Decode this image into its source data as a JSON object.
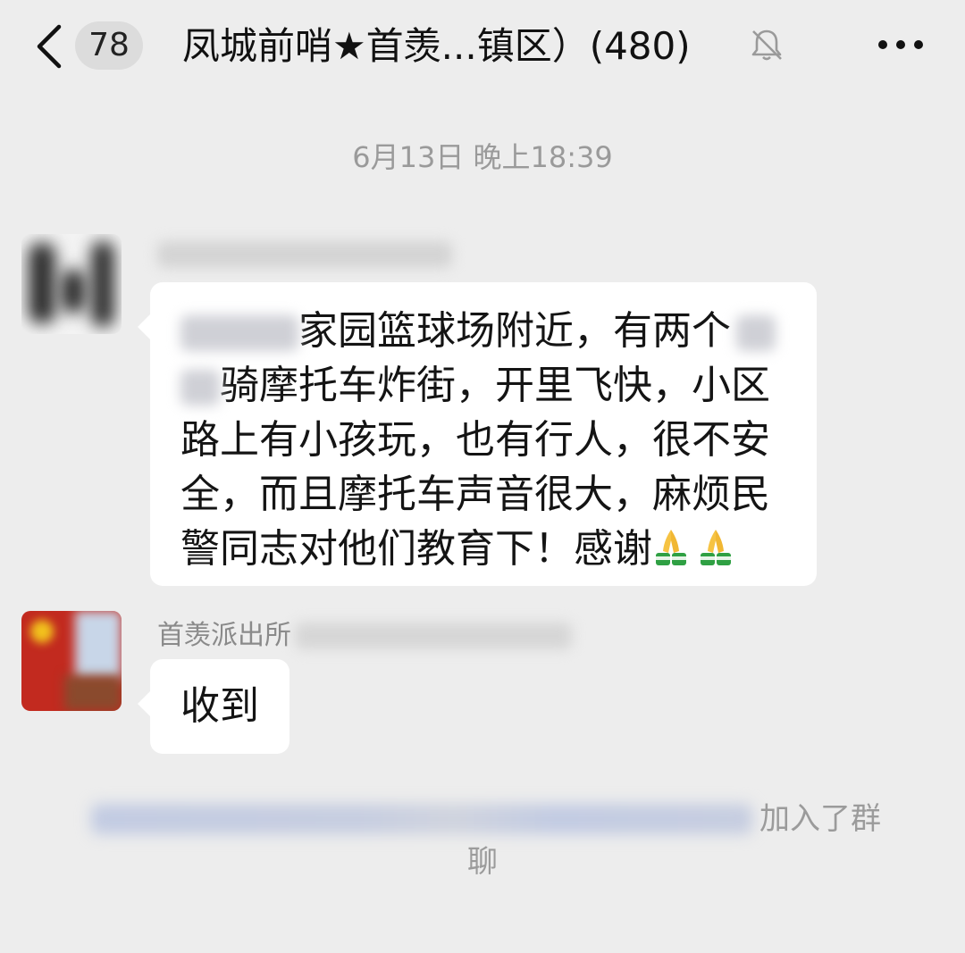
{
  "header": {
    "back_icon": "chevron-left-icon",
    "unread_count": "78",
    "title": "凤城前哨★首羡...镇区）(480)",
    "mute_icon": "bell-off-icon",
    "more_icon": "more-dots-icon"
  },
  "timestamp": "6月13日 晚上18:39",
  "messages": [
    {
      "sender_name": "",
      "text_lines": [
        "家园篮球场附近，有两个",
        "骑摩托车炸街，开里飞快，小区",
        "路上有小孩玩，也有行人，很不安",
        "全，而且摩托车声音很大，麻烦民",
        "警同志对他们教育下！感谢"
      ],
      "emoji": "folded-hands-icon"
    },
    {
      "sender_name": "首羡派出所",
      "text": "收到"
    }
  ],
  "system_message": {
    "line1_visible": "加入了群",
    "line2": "聊"
  },
  "colors": {
    "background": "#ededed",
    "bubble": "#ffffff",
    "timestamp": "#9a9a9a"
  }
}
